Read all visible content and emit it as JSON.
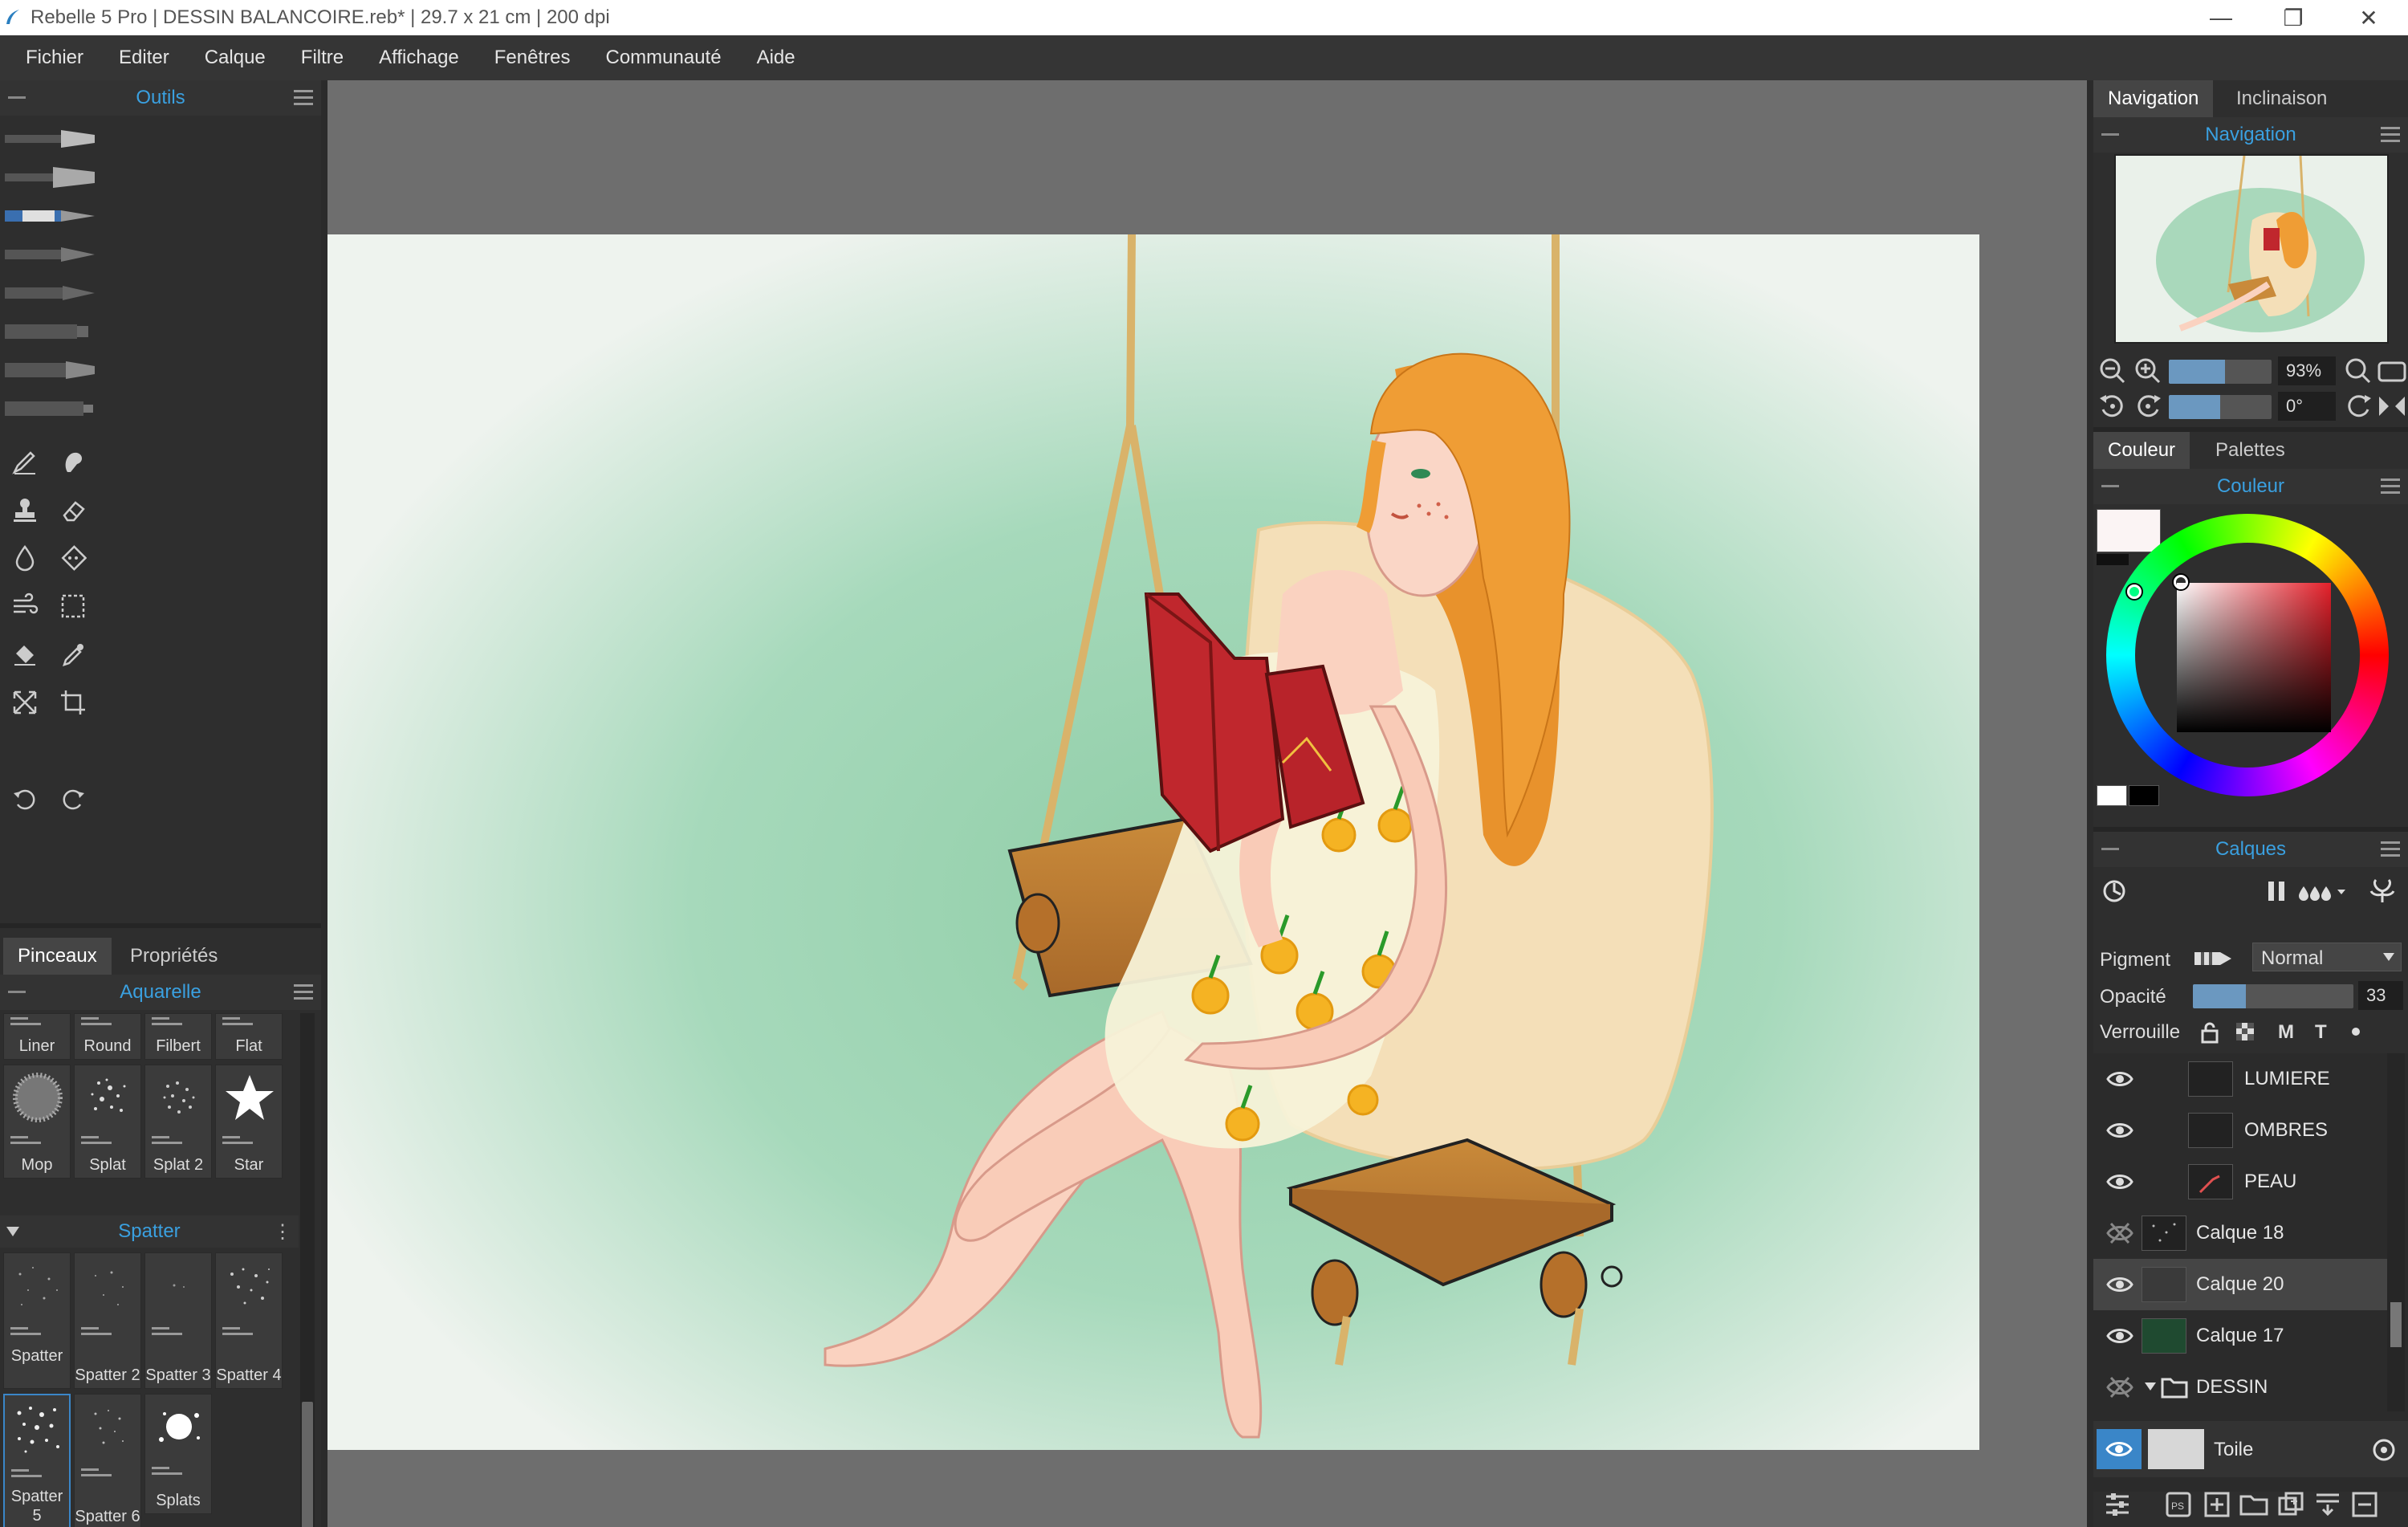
{
  "window": {
    "title": "Rebelle 5 Pro | DESSIN BALANCOIRE.reb* | 29.7 x 21 cm | 200 dpi",
    "minimize_icon": "minimize-icon",
    "maximize_icon": "restore-icon",
    "close_icon": "close-icon"
  },
  "menu": [
    "Fichier",
    "Editer",
    "Calque",
    "Filtre",
    "Affichage",
    "Fenêtres",
    "Communauté",
    "Aide"
  ],
  "tools_panel": {
    "title": "Outils",
    "brushes": [
      "watercolor-brush",
      "acrylic-brush",
      "pencil-brush",
      "ink-pen",
      "marker",
      "pastel",
      "airbrush",
      "palette-knife"
    ],
    "tools": [
      "pen-tool",
      "smudge-tool",
      "stamp-tool",
      "eraser-tool",
      "water-drop-tool",
      "blend-tool",
      "blow-tool",
      "selection-tool",
      "fill-tool",
      "eyedropper-tool",
      "transform-tool",
      "crop-tool"
    ],
    "undo_icon": "undo-icon",
    "redo_icon": "redo-icon"
  },
  "brush_panel": {
    "tabs": [
      "Pinceaux",
      "Propriétés"
    ],
    "active_tab": "Pinceaux",
    "category": "Aquarelle",
    "top_row": [
      "Liner",
      "Round",
      "Filbert",
      "Flat"
    ],
    "second_row": [
      "Mop",
      "Splat",
      "Splat 2",
      "Star"
    ],
    "group_name": "Spatter",
    "spatter_row1": [
      "Spatter",
      "Spatter 2",
      "Spatter 3",
      "Spatter 4"
    ],
    "spatter_row2": [
      "Spatter 5",
      "Spatter 6",
      "Splats"
    ],
    "selected_brush": "Spatter 5"
  },
  "navigation": {
    "tabs": [
      "Navigation",
      "Inclinaison"
    ],
    "active_tab": "Navigation",
    "title": "Navigation",
    "zoom": "93%",
    "zoom_level": 0.55,
    "rotation": "0°",
    "rotation_level": 0.5
  },
  "color": {
    "tabs": [
      "Couleur",
      "Palettes"
    ],
    "active_tab": "Couleur",
    "title": "Couleur",
    "current_color": "#fbf4f4",
    "hue": "#e5202a"
  },
  "layers": {
    "title": "Calques",
    "pigment_label": "Pigment",
    "blend_mode": "Normal",
    "opacity_label": "Opacité",
    "opacity_value": "33",
    "opacity_level": 0.33,
    "lock_label": "Verrouille",
    "lock_letters": [
      "M",
      "T"
    ],
    "items": [
      {
        "name": "LUMIERE",
        "visible": true,
        "indent": true
      },
      {
        "name": "OMBRES",
        "visible": true,
        "indent": true
      },
      {
        "name": "PEAU",
        "visible": true,
        "indent": true
      },
      {
        "name": "Calque 18",
        "visible": false,
        "indent": false
      },
      {
        "name": "Calque 20",
        "visible": true,
        "indent": false,
        "selected": true
      },
      {
        "name": "Calque 17",
        "visible": true,
        "indent": false
      },
      {
        "name": "DESSIN",
        "visible": false,
        "indent": false,
        "folder": true
      }
    ],
    "canvas_layer": "Toile"
  },
  "colors": {
    "accent": "#3aa0e0",
    "paper": "#eef3ee",
    "wash": "#9fd4b4"
  }
}
